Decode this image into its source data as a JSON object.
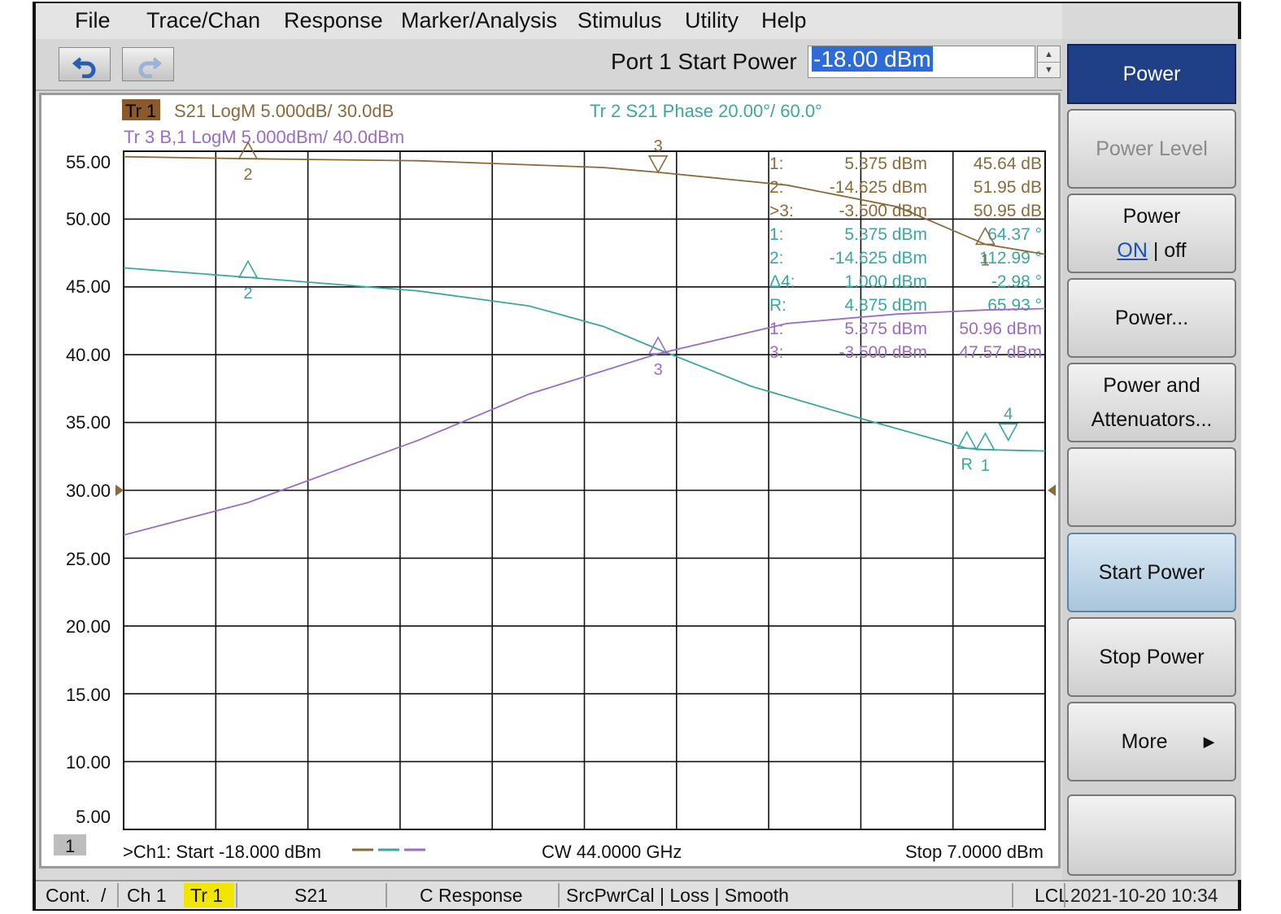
{
  "menu": {
    "items": [
      "File",
      "Trace/Chan",
      "Response",
      "Marker/Analysis",
      "Stimulus",
      "Utility",
      "Help"
    ]
  },
  "toolbar": {
    "undo_icon": "undo-arrow-icon",
    "redo_icon": "redo-arrow-icon"
  },
  "entry": {
    "label": "Port 1 Start Power",
    "value": "-18.00 dBm"
  },
  "softkeys": {
    "title": "Power",
    "power_level": "Power Level",
    "power_on_off_title": "Power",
    "power_on": "ON",
    "power_sep": "|",
    "power_off": "off",
    "power_dialog": "Power...",
    "power_atten_line1": "Power and",
    "power_atten_line2": "Attenuators...",
    "blank": "",
    "start_power": "Start Power",
    "stop_power": "Stop Power",
    "more": "More",
    "more_arrow": "▶"
  },
  "traces": {
    "tr1_badge": "Tr 1",
    "tr1_label": "S21 LogM 5.000dB/ 30.0dB",
    "tr2_label": "Tr 2  S21 Phase 20.00°/ 60.0°",
    "tr3_label": "Tr 3  B,1 LogM 5.000dBm/ 40.0dBm"
  },
  "colors": {
    "tr1": "#8a6a3a",
    "tr2": "#3aa7a0",
    "tr3": "#9a6cc2",
    "grid": "#111111",
    "tr1_badge_bg": "#8a5a2a"
  },
  "chart": {
    "footer_channel": "1",
    "footer_start": ">Ch1:  Start  -18.000 dBm",
    "footer_cw": "CW  44.0000 GHz",
    "footer_stop": "Stop  7.0000 dBm"
  },
  "chart_data": {
    "type": "line",
    "xlim": [
      -18.0,
      7.0
    ],
    "ylim": [
      2.5,
      52.5
    ],
    "ytick_labels": [
      "55.00",
      "50.00",
      "45.00",
      "40.00",
      "35.00",
      "30.00",
      "25.00",
      "20.00",
      "15.00",
      "10.00",
      "5.00"
    ],
    "series": [
      {
        "name": "Tr 1  S21 LogM",
        "color": "#8a6a3a",
        "x": [
          -18.0,
          -14.625,
          -10,
          -5,
          -3.5,
          0,
          3,
          5.375,
          7.0
        ],
        "y": [
          52.1,
          51.95,
          51.8,
          51.3,
          50.95,
          50.0,
          48.4,
          45.64,
          44.9
        ]
      },
      {
        "name": "Tr 2  S21 Phase",
        "color": "#3aa7a0",
        "x": [
          -18.0,
          -14.625,
          -10,
          -7,
          -5,
          -3.5,
          -1,
          2,
          4.875,
          5.375,
          7.0
        ],
        "y": [
          43.9,
          43.2,
          42.2,
          41.1,
          39.6,
          37.9,
          35.2,
          32.8,
          30.6,
          30.5,
          30.4
        ]
      },
      {
        "name": "Tr 3  B,1 LogM",
        "color": "#9a6cc2",
        "x": [
          -18.0,
          -14.625,
          -10,
          -7,
          -3.5,
          0,
          3,
          5.375,
          7.0
        ],
        "y": [
          24.2,
          26.6,
          31.2,
          34.6,
          37.57,
          39.8,
          40.5,
          40.8,
          40.9
        ]
      }
    ],
    "markers": [
      {
        "trace": 1,
        "label": "2",
        "x": -14.625,
        "y": 51.95
      },
      {
        "trace": 1,
        "label": "3",
        "x": -3.5,
        "y": 50.95
      },
      {
        "trace": 1,
        "label": "1",
        "x": 5.375,
        "y": 45.64
      },
      {
        "trace": 2,
        "label": "2",
        "x": -14.625,
        "y": 43.2
      },
      {
        "trace": 2,
        "label": "R",
        "x": 4.875,
        "y": 30.6
      },
      {
        "trace": 2,
        "label": "1",
        "x": 5.375,
        "y": 30.5
      },
      {
        "trace": 2,
        "label": "4",
        "x": 6.0,
        "y": 31.2
      },
      {
        "trace": 3,
        "label": "3",
        "x": -3.5,
        "y": 37.57
      }
    ],
    "marker_table": [
      {
        "c1": "1:",
        "c2": "5.375 dBm",
        "c3": "45.64 dB",
        "color": "#8a6a3a"
      },
      {
        "c1": "2:",
        "c2": "-14.625 dBm",
        "c3": "51.95 dB",
        "color": "#8a6a3a"
      },
      {
        "c1": ">3:",
        "c2": "-3.500 dBm",
        "c3": "50.95 dB",
        "color": "#8a6a3a"
      },
      {
        "c1": "1:",
        "c2": "5.375 dBm",
        "c3": "64.37 °",
        "color": "#3aa7a0"
      },
      {
        "c1": "2:",
        "c2": "-14.625 dBm",
        "c3": "112.99 °",
        "color": "#3aa7a0"
      },
      {
        "c1": "Δ4:",
        "c2": "1.000 dBm",
        "c3": "-2.98 °",
        "color": "#3aa7a0"
      },
      {
        "c1": "R:",
        "c2": "4.875 dBm",
        "c3": "65.93 °",
        "color": "#3aa7a0"
      },
      {
        "c1": "1:",
        "c2": "5.375 dBm",
        "c3": "50.96 dBm",
        "color": "#9a6cc2"
      },
      {
        "c1": "3:",
        "c2": "-3.500 dBm",
        "c3": "47.57 dBm",
        "color": "#9a6cc2"
      }
    ]
  },
  "status": {
    "cont": "Cont.",
    "slash": "/",
    "ch": "Ch 1",
    "tr": "Tr 1",
    "param": "S21",
    "cal": "C  Response",
    "flags": "SrcPwrCal | Loss | Smooth",
    "lcl": "LCL",
    "datetime": "2021-10-20 10:34"
  }
}
